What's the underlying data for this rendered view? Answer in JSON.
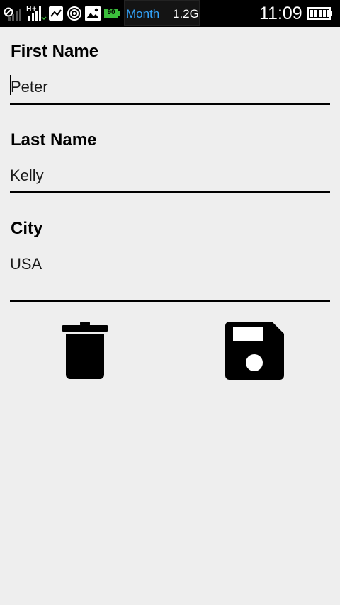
{
  "status_bar": {
    "battery_saver_label": "90",
    "data_period": "Month",
    "data_amount": "1.2G",
    "time": "11:09"
  },
  "form": {
    "first_name": {
      "label": "First Name",
      "value": "Peter"
    },
    "last_name": {
      "label": "Last Name",
      "value": "Kelly"
    },
    "city": {
      "label": "City",
      "value": "USA"
    }
  },
  "actions": {
    "delete_icon": "trash-icon",
    "save_icon": "floppy-disk-icon"
  },
  "colors": {
    "background": "#eeeeee",
    "status_bar": "#000000",
    "usage_text": "#33a6ff",
    "battery_saver": "#3cbf3c"
  }
}
